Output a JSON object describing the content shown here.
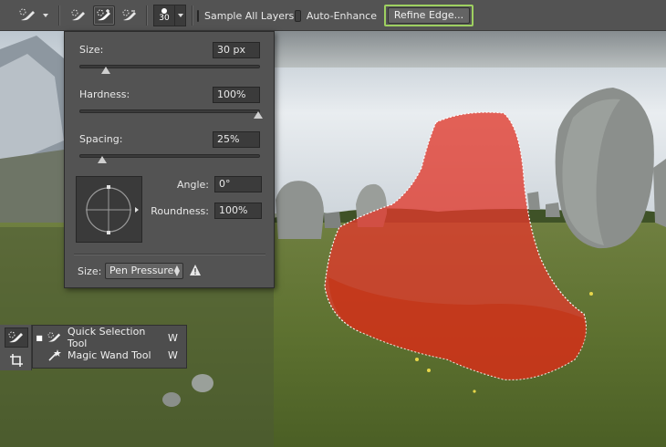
{
  "options_bar": {
    "tool_preset_icon": "quick-selection-brush-icon",
    "mode_buttons": [
      {
        "icon": "new-selection-brush-icon",
        "active": false
      },
      {
        "icon": "add-to-selection-brush-icon",
        "active": true
      },
      {
        "icon": "subtract-from-selection-brush-icon",
        "active": false
      }
    ],
    "brush_size": "30",
    "sample_all_layers_label": "Sample All Layers",
    "sample_all_layers_checked": false,
    "auto_enhance_label": "Auto-Enhance",
    "auto_enhance_checked": false,
    "refine_edge_label": "Refine Edge...",
    "refine_edge_highlight": "#9ed060"
  },
  "brush_panel": {
    "size_label": "Size:",
    "size_value": "30 px",
    "size_fraction": 0.14,
    "hardness_label": "Hardness:",
    "hardness_value": "100%",
    "hardness_fraction": 1.0,
    "spacing_label": "Spacing:",
    "spacing_value": "25%",
    "spacing_fraction": 0.12,
    "angle_label": "Angle:",
    "angle_value": "0°",
    "roundness_label": "Roundness:",
    "roundness_value": "100%",
    "pressure_label": "Size:",
    "pressure_value": "Pen Pressure",
    "warning_icon": "warning-triangle-icon"
  },
  "tools": {
    "active_icon": "quick-selection-tool-icon",
    "secondary_icon": "crop-tool-icon",
    "flyout": [
      {
        "label": "Quick Selection Tool",
        "shortcut": "W",
        "icon": "quick-selection-tool-icon",
        "selected": true
      },
      {
        "label": "Magic Wand Tool",
        "shortcut": "W",
        "icon": "magic-wand-icon",
        "selected": false
      }
    ]
  },
  "canvas": {
    "selection_color": "#e0392b"
  }
}
